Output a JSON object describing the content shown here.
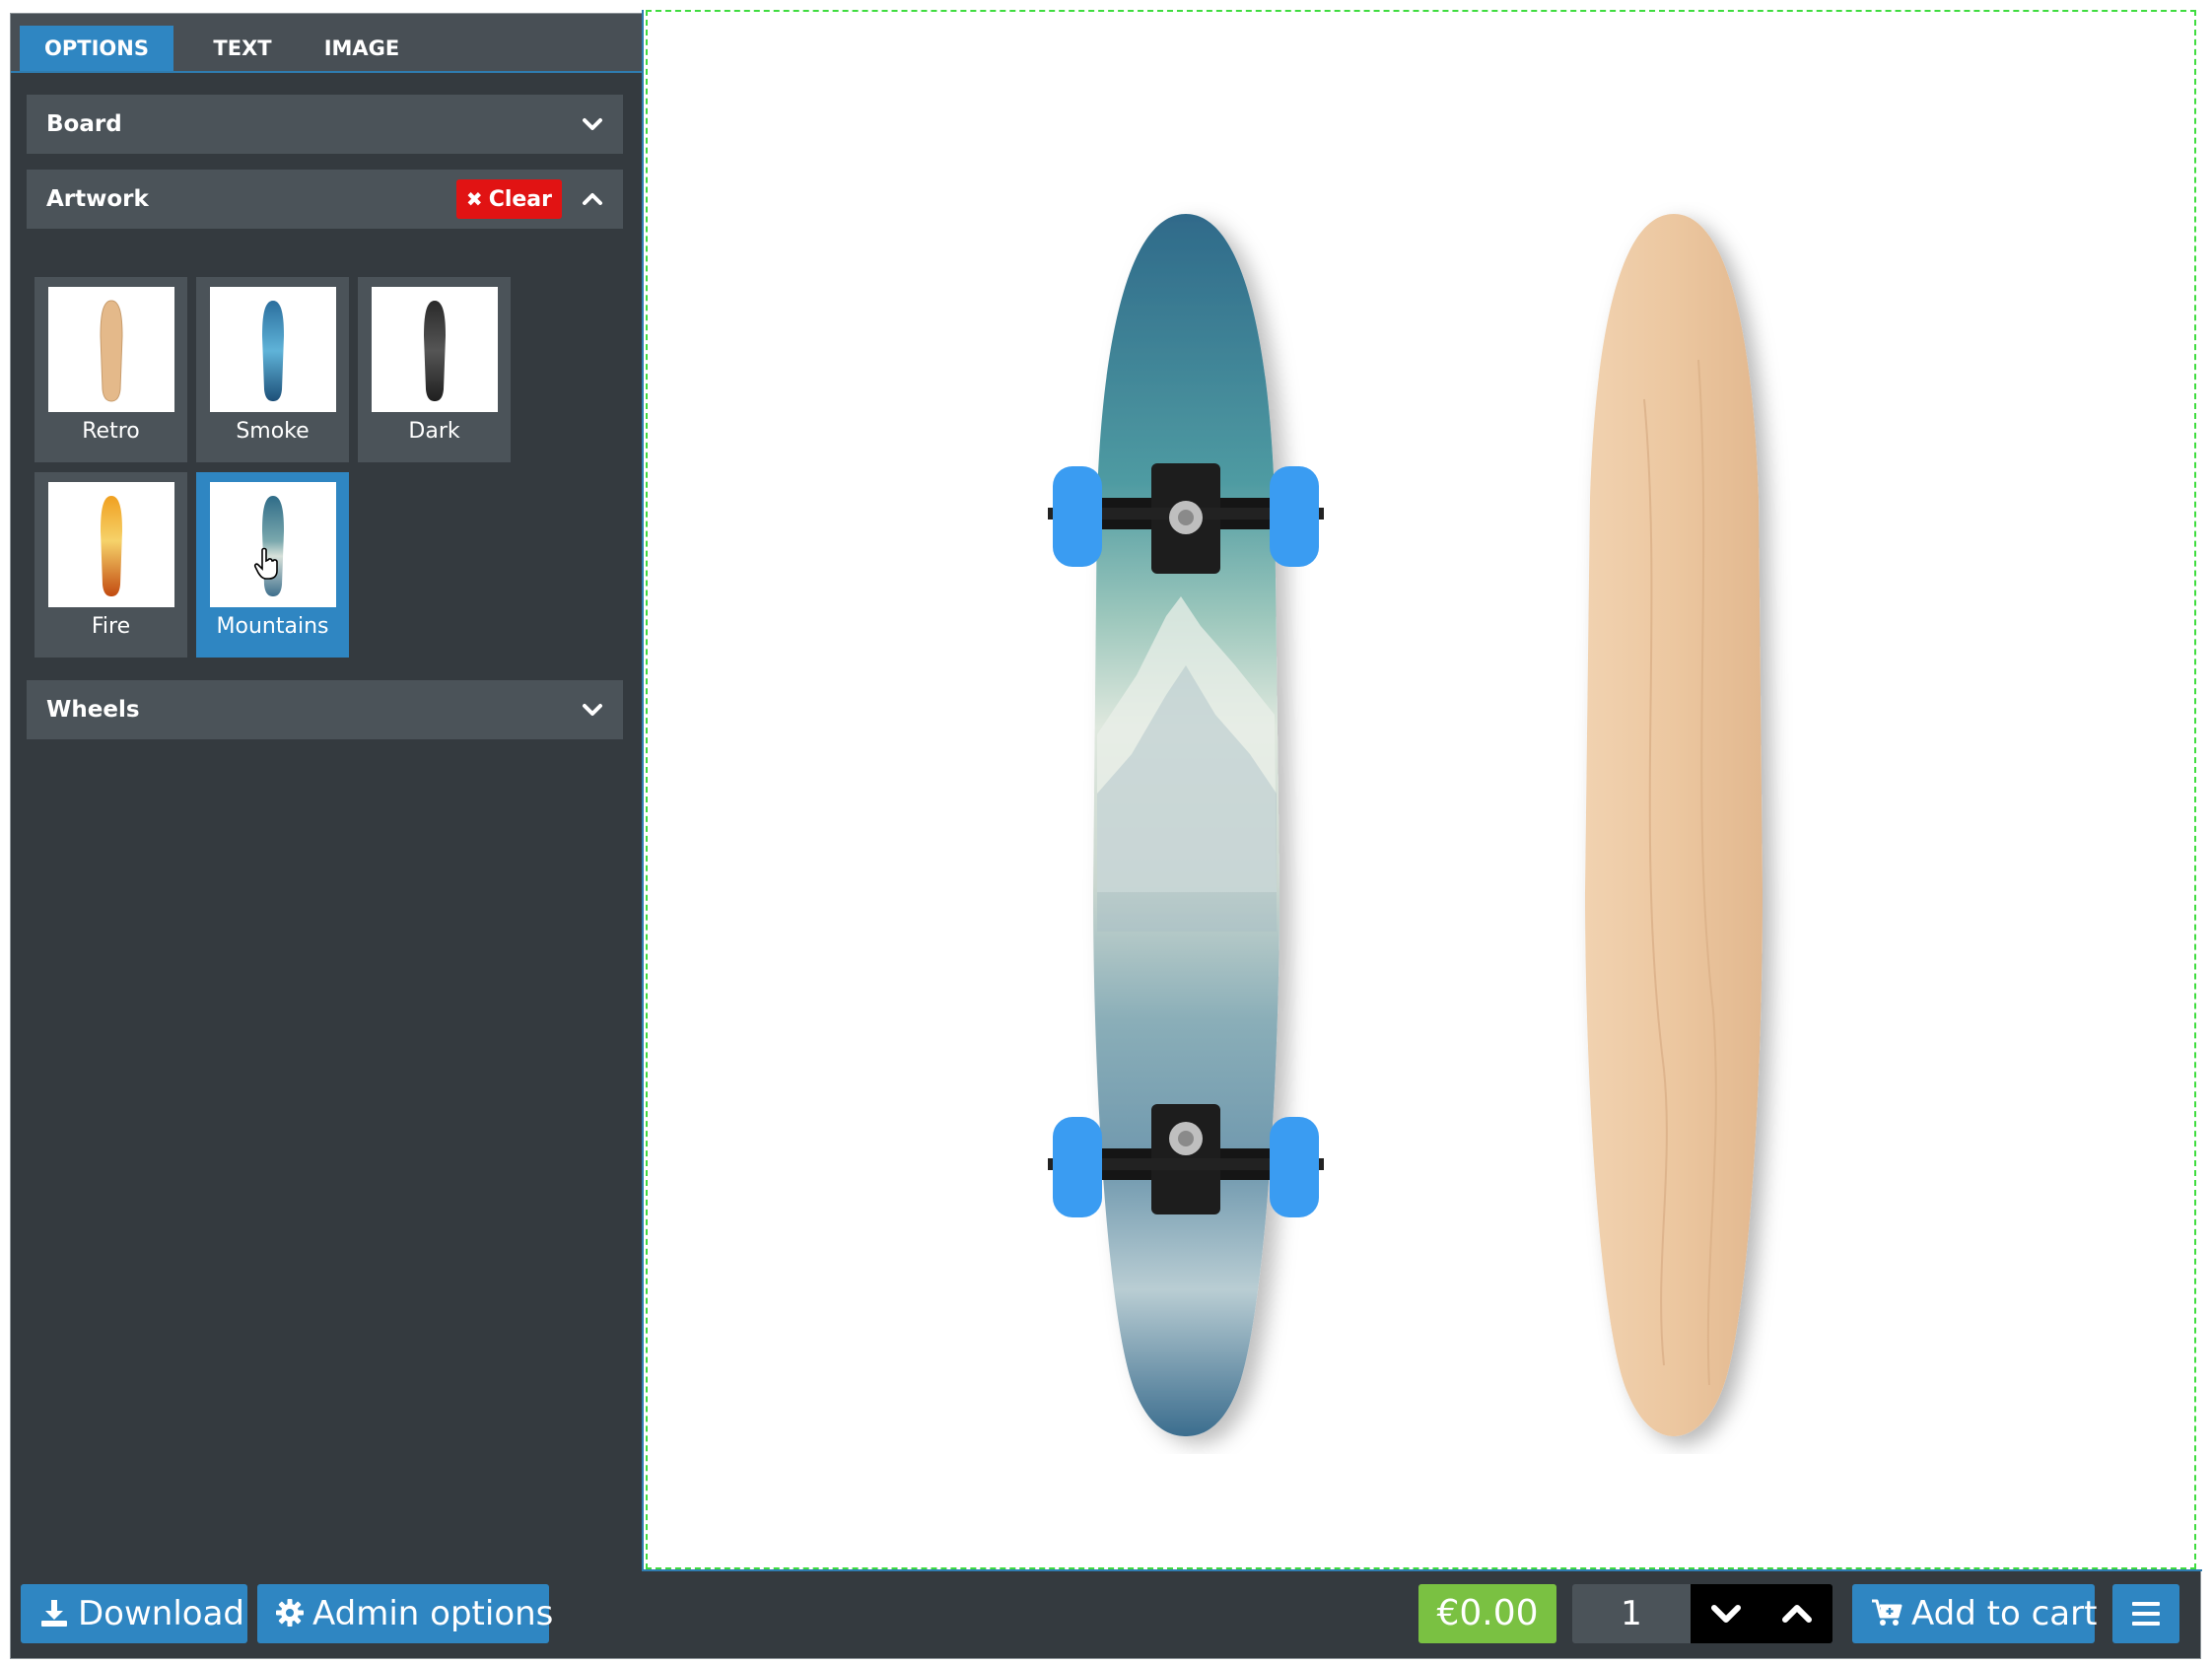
{
  "tabs": [
    {
      "label": "OPTIONS",
      "active": true
    },
    {
      "label": "TEXT",
      "active": false
    },
    {
      "label": "IMAGE",
      "active": false
    }
  ],
  "accordion": {
    "board": {
      "title": "Board",
      "icon": "chevron-down-icon"
    },
    "artwork": {
      "title": "Artwork",
      "clear_label": "Clear",
      "icon": "chevron-up-icon"
    },
    "wheels": {
      "title": "Wheels",
      "icon": "chevron-down-icon"
    }
  },
  "artwork_options": [
    {
      "label": "Retro",
      "selected": false
    },
    {
      "label": "Smoke",
      "selected": false
    },
    {
      "label": "Dark",
      "selected": false
    },
    {
      "label": "Fire",
      "selected": false
    },
    {
      "label": "Mountains",
      "selected": true
    }
  ],
  "bottom": {
    "download_label": "Download",
    "admin_label": "Admin options",
    "price": "€0.00",
    "quantity": "1",
    "add_to_cart_label": "Add to cart"
  },
  "colors": {
    "accent": "#2f86c2",
    "panel": "#343a3f",
    "header": "#4b5359",
    "danger": "#e11313",
    "price": "#7ac142",
    "selection_outline": "#3fdc3f",
    "wheel": "#3a9cf2"
  }
}
